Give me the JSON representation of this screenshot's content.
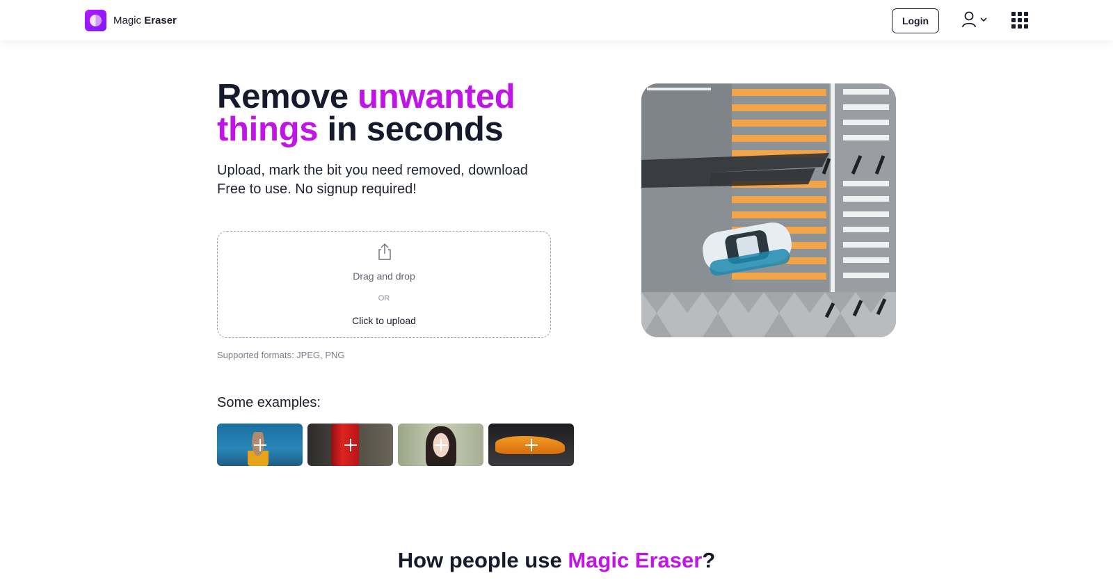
{
  "header": {
    "logo_light": "Magic",
    "logo_bold": "Eraser",
    "login_label": "Login",
    "icons": {
      "logo": "magic-eraser-logo-icon",
      "user": "user-icon",
      "chevron": "chevron-down-icon",
      "apps": "apps-grid-icon"
    }
  },
  "hero": {
    "title_part1": "Remove ",
    "title_accent1": "unwanted",
    "title_accent2": "things",
    "title_part2": " in seconds",
    "subtitle_line1": "Upload, mark the bit you need removed, download",
    "subtitle_line2": "Free to use. No signup required!",
    "image_icon": "crosswalk-car-photo"
  },
  "upload": {
    "icon": "upload-icon",
    "drag_text": "Drag and drop",
    "or_text": "OR",
    "click_text": "Click to upload",
    "formats_text": "Supported formats: JPEG, PNG"
  },
  "examples": {
    "title": "Some examples:",
    "items": [
      {
        "subject": "dog-photo"
      },
      {
        "subject": "cola-can-photo"
      },
      {
        "subject": "woman-portrait-photo"
      },
      {
        "subject": "orange-sports-car-photo"
      }
    ]
  },
  "section": {
    "title_part1": "How people use ",
    "title_accent": "Magic Eraser",
    "title_part2": "?"
  },
  "colors": {
    "accent": "#c114e6",
    "text": "#161a2b",
    "logo_gradient_start": "#b517ff",
    "logo_gradient_end": "#7a1bff"
  }
}
